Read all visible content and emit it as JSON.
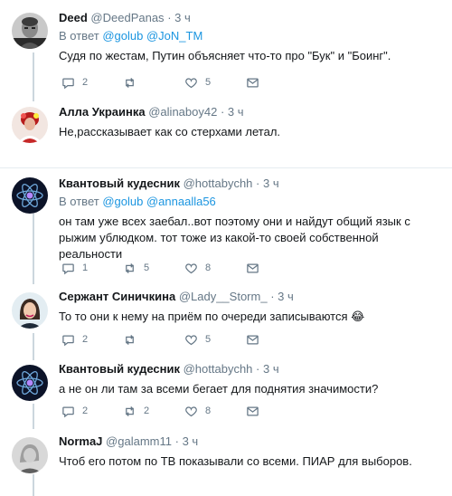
{
  "tweets": [
    {
      "name": "Deed",
      "handle": "@DeedPanas",
      "dot": "·",
      "time": "3 ч",
      "reply_prefix": "В ответ",
      "mentions": [
        "@golub",
        "@JoN_TM"
      ],
      "text": "Судя по жестам, Путин объясняет что-то про \"Бук\" и \"Боинг\".",
      "counts": {
        "reply": "2",
        "retweet": "",
        "like": "5"
      }
    },
    {
      "name": "Алла Украинка",
      "handle": "@alinaboy42",
      "dot": "·",
      "time": "3 ч",
      "text": "Не,рассказывает как со стерхами летал."
    },
    {
      "name": "Квантовый кудесник",
      "handle": "@hottabychh",
      "dot": "·",
      "time": "3 ч",
      "reply_prefix": "В ответ",
      "mentions": [
        "@golub",
        "@annaalla56"
      ],
      "text": "он там уже всех заебал..вот поэтому они и найдут общий язык с рыжим ублюдком. тот тоже из какой-то своей собственной реальности",
      "counts": {
        "reply": "1",
        "retweet": "5",
        "like": "8"
      }
    },
    {
      "name": "Сержант Синичкина",
      "handle": "@Lady__Storm_",
      "dot": "·",
      "time": "3 ч",
      "text": "То то они к нему на приём по очереди записываются",
      "emoji": "😂",
      "counts": {
        "reply": "2",
        "retweet": "",
        "like": "5"
      }
    },
    {
      "name": "Квантовый кудесник",
      "handle": "@hottabychh",
      "dot": "·",
      "time": "3 ч",
      "text": "а не он ли там за всеми бегает для поднятия значимости?",
      "counts": {
        "reply": "2",
        "retweet": "2",
        "like": "8"
      }
    },
    {
      "name": "NormaJ",
      "handle": "@galamm11",
      "dot": "·",
      "time": "3 ч",
      "text": "Чтоб его потом по ТВ показывали со всеми. ПИАР для выборов."
    }
  ],
  "colors": {
    "accent": "#1b95e0",
    "muted": "#657786",
    "line": "#ccd6dd"
  },
  "icons": [
    "reply-icon",
    "retweet-icon",
    "like-icon",
    "message-icon"
  ]
}
